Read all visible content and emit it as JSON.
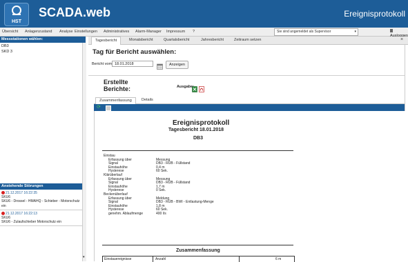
{
  "header": {
    "logo_text": "HST",
    "app_title": "SCADA.web",
    "page_title": "Ereignisprotokoll"
  },
  "menu": {
    "items": [
      "Übersicht",
      "Anlagenzustand",
      "Analyse",
      "Einstellungen",
      "Administratives",
      "Alarm-Manager",
      "Impressum",
      "?"
    ],
    "login_status": "Sie sind angemeldet als Supervisor",
    "logout": "Ausloggen"
  },
  "left_panel": {
    "title": "Messstationen wählen:",
    "stations": [
      "DB3",
      "SKD 3"
    ]
  },
  "alarms": {
    "title": "Anstehende Störungen",
    "items": [
      {
        "time": "21.12.2017 16:22:35",
        "station": "SKU6",
        "text": "SKU6 - Drossel - HMAHQ - Schieber - Motorschutz ein"
      },
      {
        "time": "21.12.2017 16:22:13",
        "station": "SKU6",
        "text": "SKU6 - Zulaufschieber Motorschutz ein"
      }
    ]
  },
  "content_tabs": [
    "Tagesbericht",
    "Monatsbericht",
    "Quartalsbericht",
    "Jahresbericht",
    "Zeitraum setzen"
  ],
  "day_select": {
    "title": "Tag für Bericht auswählen:",
    "label": "Bericht vom:",
    "date_value": "18.01.2018",
    "show_button": "Anzeigen"
  },
  "created_reports": {
    "title": "Erstellte Berichte:",
    "output_label": "Ausgabe:",
    "tabs": [
      "Zusammenfassung",
      "Details"
    ]
  },
  "report": {
    "title": "Ereignisprotokoll",
    "subtitle": "Tagesbericht 18.01.2018",
    "station": "DB3",
    "rows": [
      {
        "kind": "sec",
        "text": "Einstau"
      },
      {
        "kind": "pair",
        "label": "Erfassung über",
        "value": "Messung"
      },
      {
        "kind": "pair",
        "label": "Signal",
        "value": "DB3 - RÜB - Füllstand"
      },
      {
        "kind": "pair",
        "label": "Einstauhöhe",
        "value": "0,4 m"
      },
      {
        "kind": "pair",
        "label": "Hysterese",
        "value": "60 Sek."
      },
      {
        "kind": "sec",
        "text": "Klärüberlauf"
      },
      {
        "kind": "pair",
        "label": "Erfassung über",
        "value": "Messung"
      },
      {
        "kind": "pair",
        "label": "Signal",
        "value": "DB3 - RÜB - Füllstand"
      },
      {
        "kind": "pair",
        "label": "Einstauhöhe",
        "value": "1,7 m"
      },
      {
        "kind": "pair",
        "label": "Hysterese",
        "value": "0 Sek."
      },
      {
        "kind": "sec",
        "text": "Beckenüberlauf"
      },
      {
        "kind": "pair",
        "label": "Erfassung über",
        "value": "Meldung"
      },
      {
        "kind": "pair",
        "label": "Signal",
        "value": "DB3 - RÜB - BWI - Entlastung-Menge"
      },
      {
        "kind": "pair",
        "label": "Einstauhöhe",
        "value": "1,8 m"
      },
      {
        "kind": "pair",
        "label": "Hysterese",
        "value": "60 Sek."
      },
      {
        "kind": "pair",
        "label": "genehm. Ablaufmenge",
        "value": "400 l/s"
      }
    ],
    "summary_title": "Zusammenfassung",
    "summary_headers": [
      "Einstauereignisse",
      "Anzahl",
      "6 m"
    ]
  }
}
